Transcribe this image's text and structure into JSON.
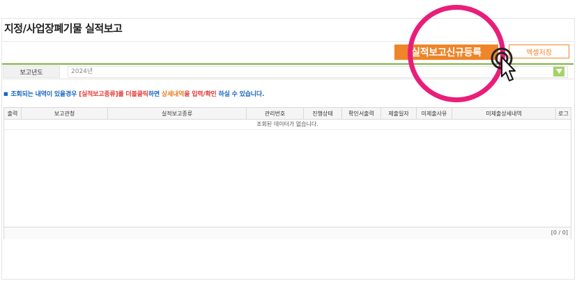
{
  "page": {
    "title": "지정/사업장폐기물 실적보고"
  },
  "toolbar": {
    "register_label": "실적보고신규등록",
    "excel_label": "엑셀저장"
  },
  "filter": {
    "year_label": "보고년도",
    "year_value": "2024년"
  },
  "notice": {
    "part1": "조회되는 내역이 있을경우 ",
    "part2": "[실적보고종류]",
    "part3": "를 더블클릭",
    "part4": "하면 ",
    "part5": "상세내역",
    "part6": "을 입력/확인",
    "part7": " 하실 수 있습니다."
  },
  "grid": {
    "columns": [
      "출력",
      "보고관청",
      "실적보고종류",
      "관리번호",
      "진행상태",
      "확인서출력",
      "제출일자",
      "미제출사유",
      "미제출상세내역",
      "로그"
    ],
    "empty_message": "조회된 데이터가 없습니다.",
    "pager": "[0 / 0]"
  },
  "colors": {
    "accent_orange": "#ee8529",
    "filter_green": "#7cb342",
    "highlight_pink": "#e91e7a",
    "notice_blue": "#1565c0",
    "notice_red": "#e53935"
  },
  "icons": [
    "dropdown-arrow-icon",
    "pointer-hand-icon"
  ]
}
